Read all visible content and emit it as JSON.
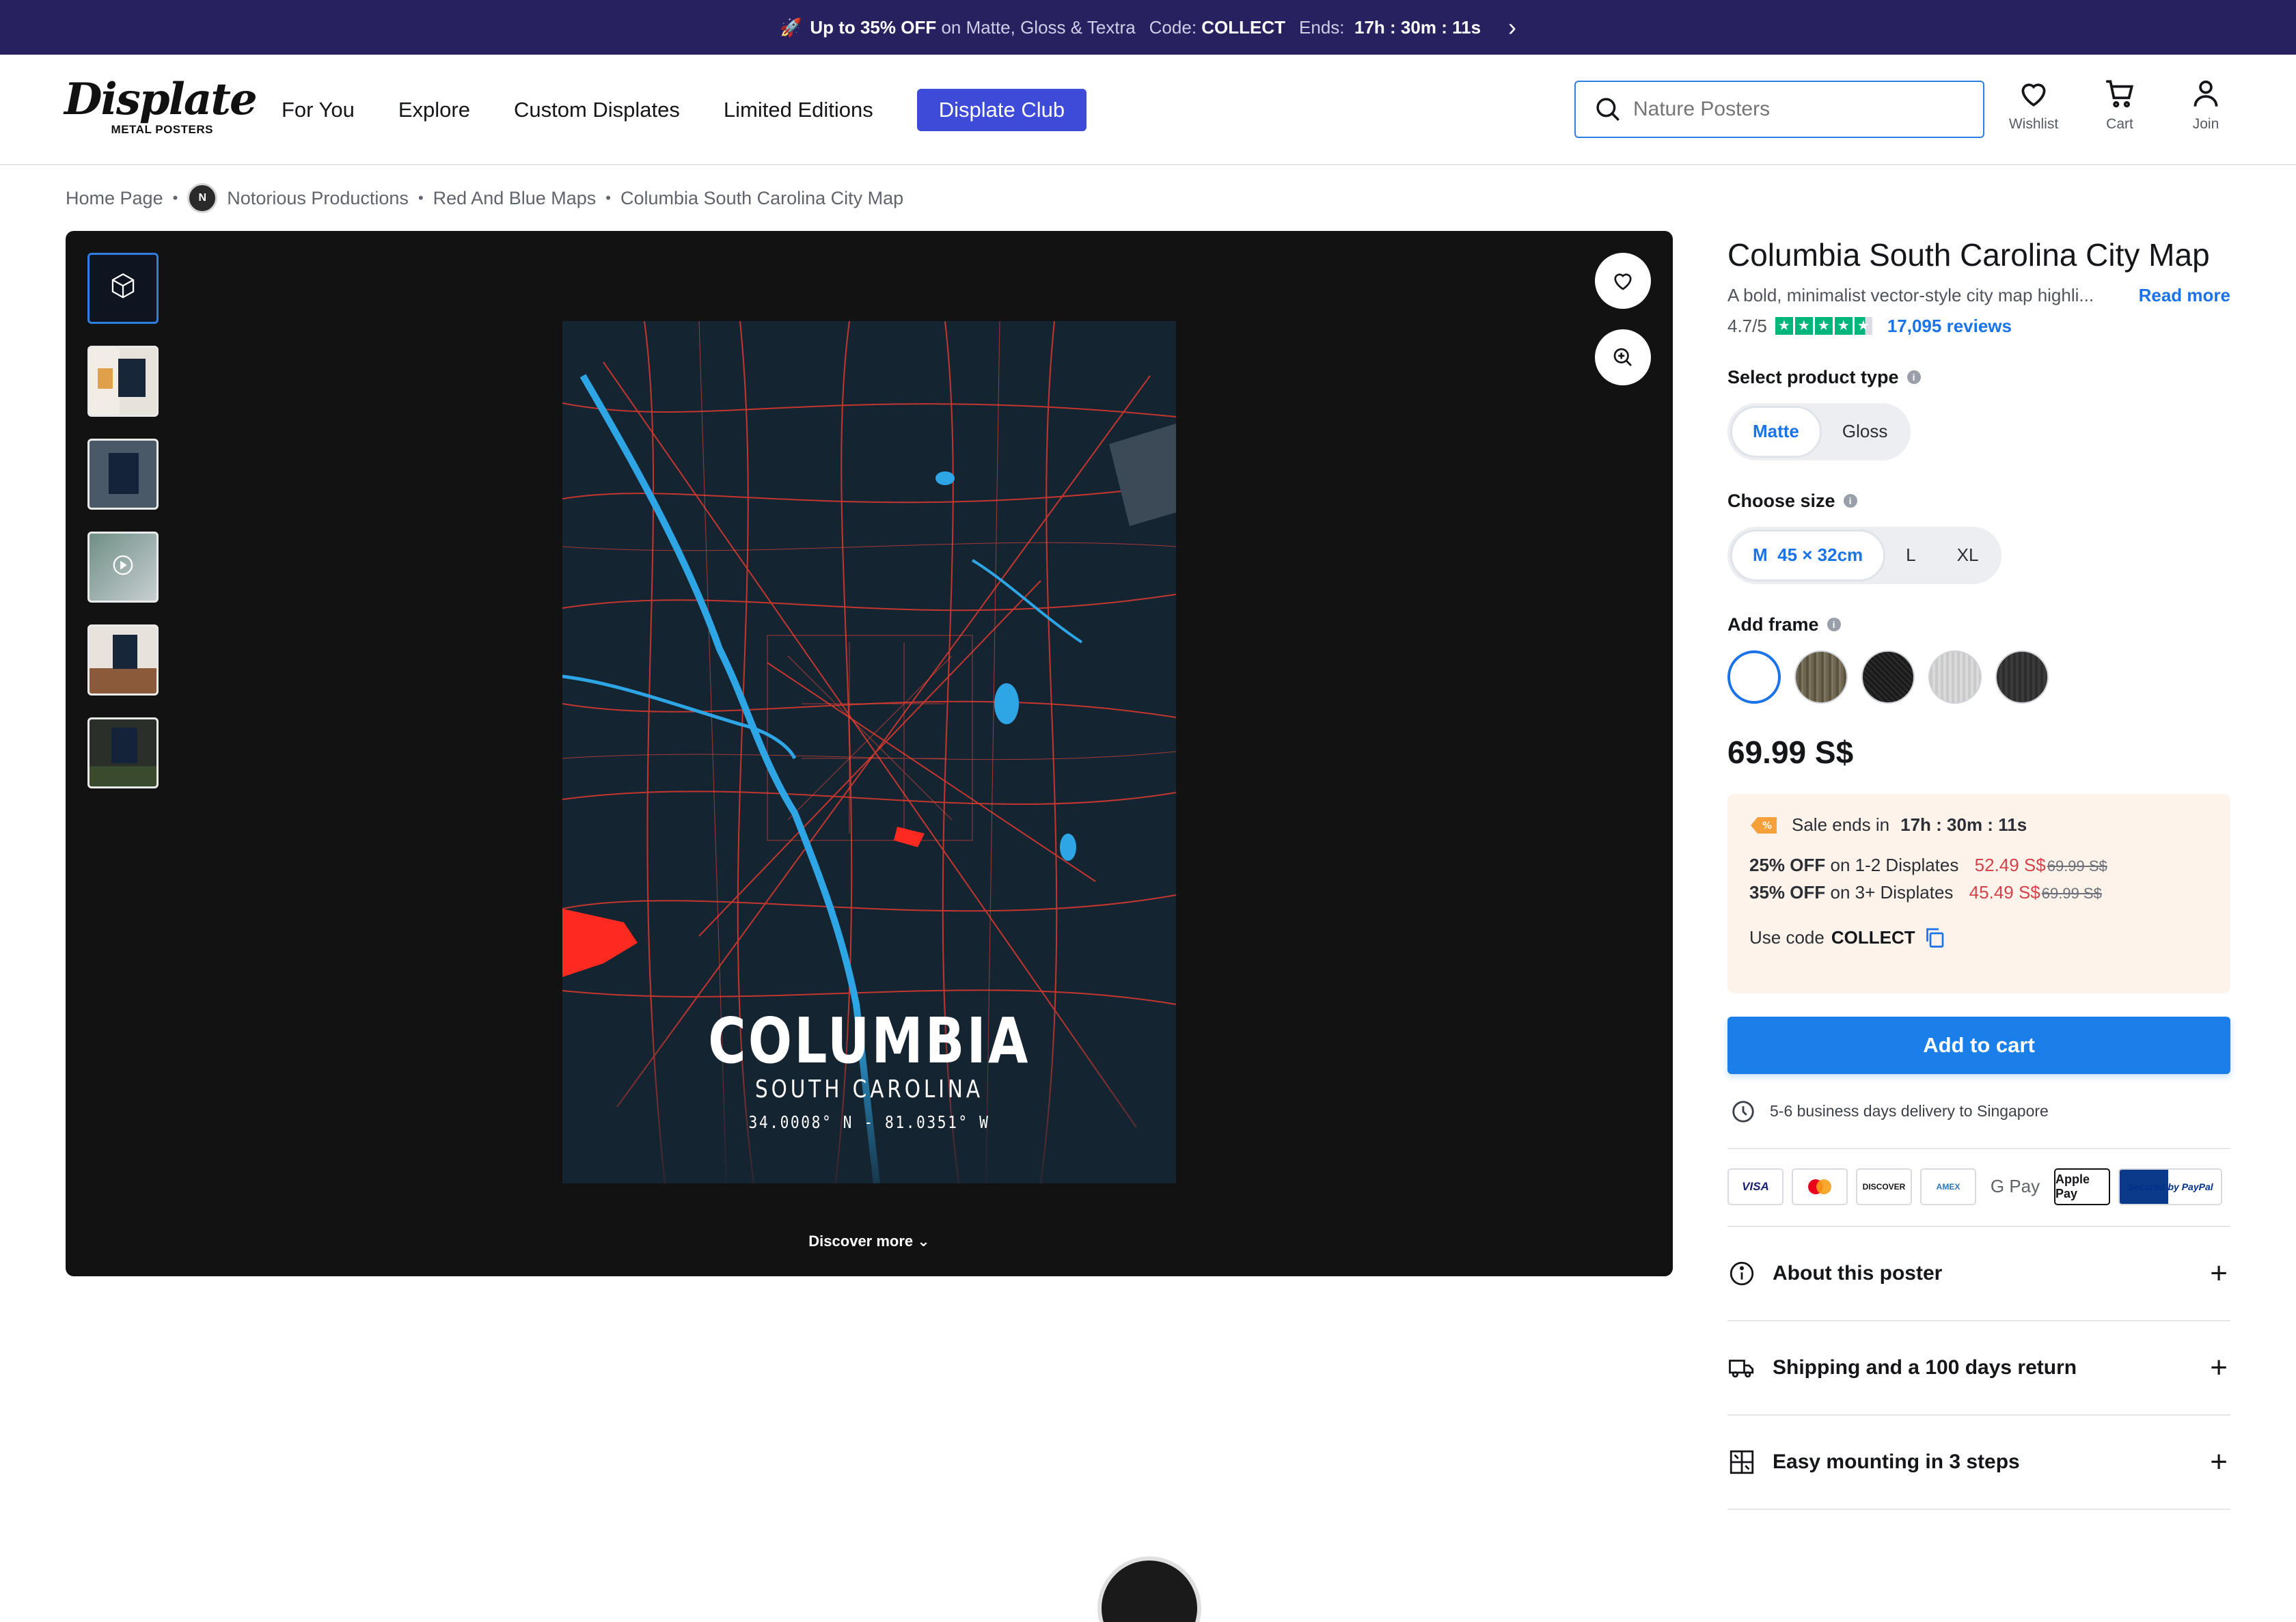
{
  "promo": {
    "rocket": "🚀",
    "headline_bold": "Up to 35% OFF",
    "headline_rest": "on Matte, Gloss & Textra",
    "code_label": "Code:",
    "code_value": "COLLECT",
    "ends_label": "Ends:",
    "ends_h": "17h",
    "ends_m": ": 30m :",
    "ends_s": "11s",
    "arrow": "›"
  },
  "header": {
    "logo_word": "Displate",
    "logo_sub": "METAL POSTERS",
    "nav": [
      "For You",
      "Explore",
      "Custom Displates",
      "Limited Editions"
    ],
    "club": "Displate Club",
    "search_placeholder": "Nature Posters",
    "wishlist": "Wishlist",
    "cart": "Cart",
    "join": "Join"
  },
  "breadcrumb": {
    "home": "Home Page",
    "artist": "Notorious Productions",
    "collection": "Red And Blue Maps",
    "current": "Columbia South Carolina City Map"
  },
  "poster": {
    "city": "COLUMBIA",
    "state": "SOUTH CAROLINA",
    "coords": "34.0008° N - 81.0351° W",
    "discover": "Discover more ⌄"
  },
  "product": {
    "title": "Columbia South Carolina City Map",
    "description": "A bold, minimalist vector-style city map highli...",
    "read_more": "Read more",
    "rating": "4.7/5",
    "stars": 4.7,
    "reviews": "17,095 reviews",
    "type_label": "Select product type",
    "types": [
      "Matte",
      "Gloss"
    ],
    "size_label": "Choose size",
    "sizes": [
      "M  45 × 32cm",
      "L",
      "XL"
    ],
    "frame_label": "Add frame",
    "price": "69.99 S$",
    "sale_label": "Sale ends in",
    "sale_h": "17h",
    "sale_m": ": 30m :",
    "sale_s": "11s",
    "offer1_pct": "25% OFF",
    "offer1_on": "on 1-2 Displates",
    "offer1_price": "52.49 S$",
    "offer1_orig": "69.99 S$",
    "offer2_pct": "35% OFF",
    "offer2_on": "on 3+ Displates",
    "offer2_price": "45.49 S$",
    "offer2_orig": "69.99 S$",
    "use_code": "Use code",
    "code": "COLLECT",
    "add_to_cart": "Add to cart",
    "delivery": "5-6 business days delivery to Singapore",
    "payments": [
      "VISA",
      "MC",
      "DISCOVER",
      "AMEX",
      "G Pay",
      "Apple Pay",
      "Secured by PayPal"
    ],
    "accordion": [
      "About this poster",
      "Shipping and a 100 days return",
      "Easy mounting in 3 steps"
    ]
  },
  "colors": {
    "promo_bg": "#27215f",
    "club_btn": "#3d4bd8",
    "accent": "#1a73e8",
    "cart_btn": "#1a7fe8",
    "sale_bg": "#fdf3ea",
    "sale_red": "#d6424a",
    "poster_bg": "#142431",
    "map_red": "#e8392f",
    "map_blue": "#2ea6e6"
  }
}
